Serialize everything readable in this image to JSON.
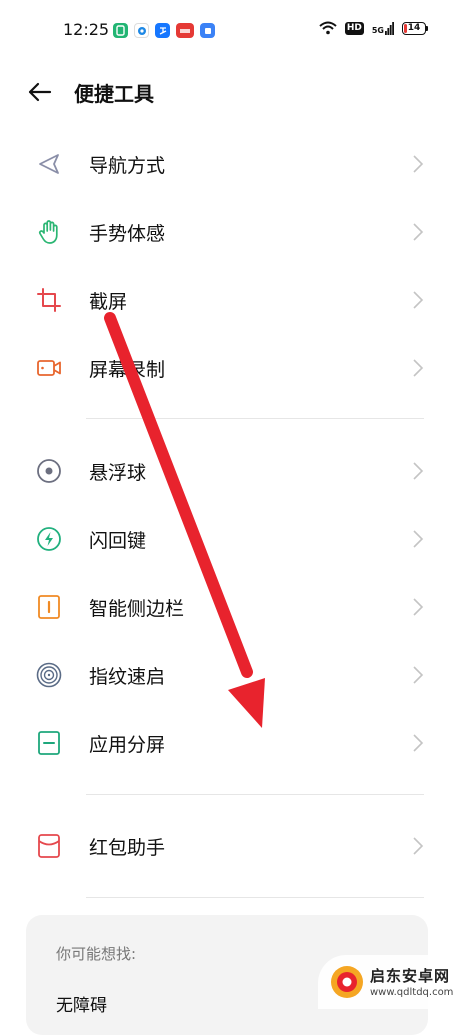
{
  "status_bar": {
    "time": "12:25",
    "hd": "HD",
    "signal_label": "5G",
    "battery": "14",
    "battery_level": 0.14
  },
  "header": {
    "title": "便捷工具"
  },
  "sections": [
    {
      "items": [
        {
          "label": "导航方式",
          "icon": "navigation-icon"
        },
        {
          "label": "手势体感",
          "icon": "hand-gesture-icon"
        },
        {
          "label": "截屏",
          "icon": "crop-icon"
        },
        {
          "label": "屏幕录制",
          "icon": "screen-record-icon"
        }
      ]
    },
    {
      "items": [
        {
          "label": "悬浮球",
          "icon": "floating-ball-icon"
        },
        {
          "label": "闪回键",
          "icon": "flash-back-icon"
        },
        {
          "label": "智能侧边栏",
          "icon": "sidebar-icon"
        },
        {
          "label": "指纹速启",
          "icon": "fingerprint-icon"
        },
        {
          "label": "应用分屏",
          "icon": "split-screen-icon"
        }
      ]
    },
    {
      "items": [
        {
          "label": "红包助手",
          "icon": "red-envelope-icon"
        }
      ]
    }
  ],
  "suggestions": {
    "title": "你可能想找:",
    "items": [
      "无障碍"
    ]
  },
  "watermark": {
    "line1": "启东安卓网",
    "line2": "www.qdltdq.com"
  },
  "colors": {
    "annotation_arrow": "#e8232d",
    "navigation": "#8a8fa8",
    "gesture": "#2bb673",
    "crop": "#e5484d",
    "record": "#e8662e",
    "floating": "#6c6f80",
    "flash": "#21b07e",
    "sidebar": "#f08a24",
    "fingerprint": "#5a6b86",
    "split": "#1ea77c",
    "envelope": "#e5484d"
  }
}
